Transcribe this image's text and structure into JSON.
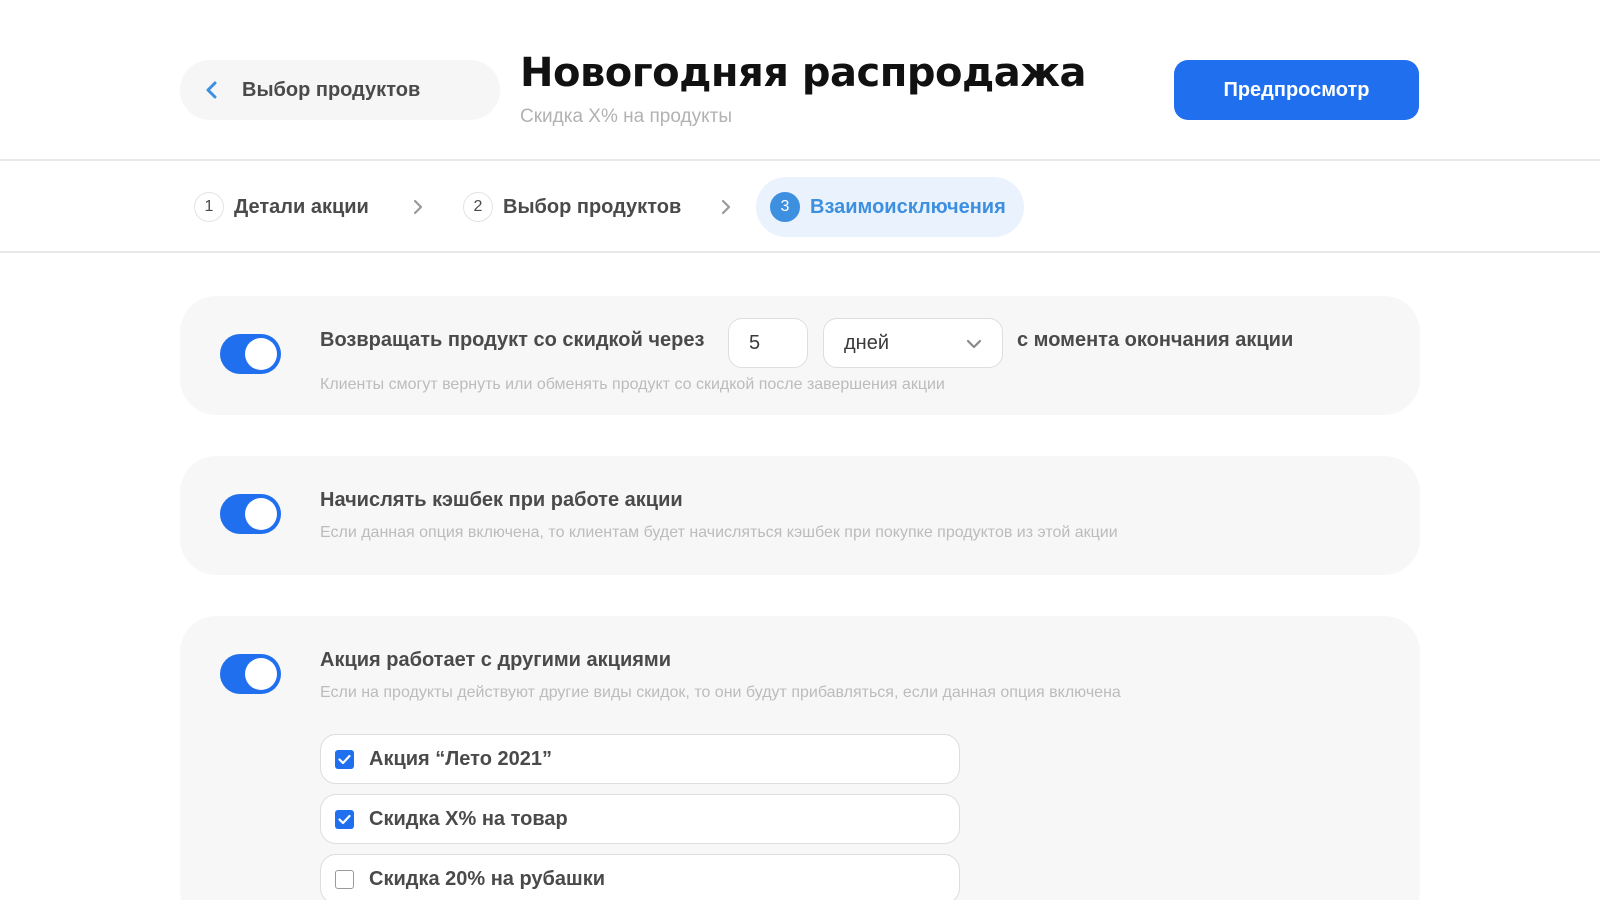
{
  "header": {
    "back_label": "Выбор продуктов",
    "title": "Новогодняя распродажа",
    "subtitle": "Скидка X% на продукты",
    "preview_label": "Предпросмотр"
  },
  "stepper": {
    "steps": [
      {
        "num": "1",
        "label": "Детали акции"
      },
      {
        "num": "2",
        "label": "Выбор продуктов"
      },
      {
        "num": "3",
        "label": "Взаимоисключения"
      }
    ]
  },
  "return_option": {
    "enabled": true,
    "prefix": "Возвращать продукт со скидкой через",
    "value": "5",
    "unit": "дней",
    "suffix": "с момента окончания акции",
    "description": "Клиенты смогут вернуть или обменять продукт со скидкой после завершения акции"
  },
  "cashback_option": {
    "enabled": true,
    "title": "Начислять кэшбек при работе акции",
    "description": "Если данная опция включена, то клиентам будет начисляться кэшбек при покупке продуктов из этой акции"
  },
  "combine_option": {
    "enabled": true,
    "title": "Акция работает с другими акциями",
    "description": "Если на продукты действуют другие виды скидок, то они будут прибавляться, если данная опция включена",
    "items": [
      {
        "label": "Акция “Лето 2021”",
        "checked": true
      },
      {
        "label": "Скидка X% на товар",
        "checked": true
      },
      {
        "label": "Скидка 20% на рубашки",
        "checked": false
      }
    ]
  },
  "colors": {
    "accent": "#1f6fef",
    "step_active": "#3d8fe0",
    "card_bg": "#f7f7f7"
  }
}
